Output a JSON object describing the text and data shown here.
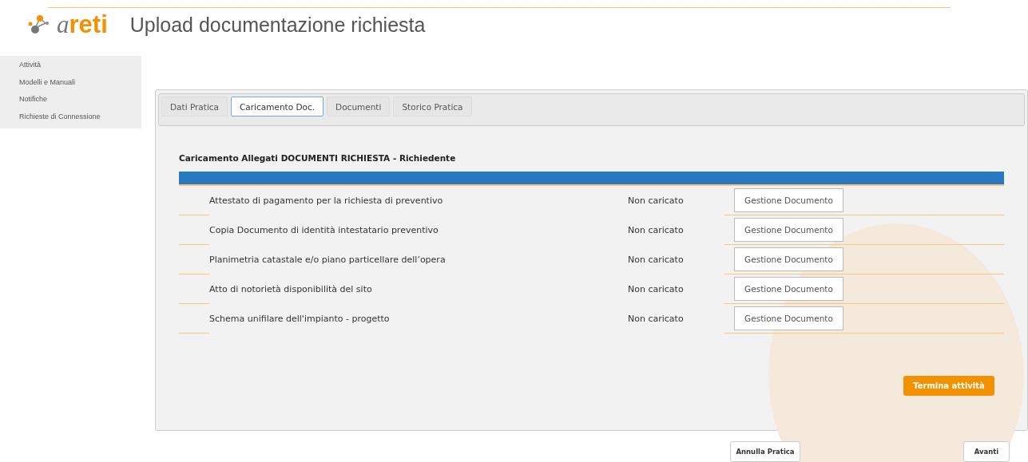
{
  "logo": {
    "prefix": "a",
    "name": "reti"
  },
  "page_title": "Upload documentazione richiesta",
  "sidebar": {
    "items": [
      {
        "label": "Attività"
      },
      {
        "label": "Modelli e Manuali"
      },
      {
        "label": "Notifiche"
      },
      {
        "label": "Richieste di Connessione"
      }
    ]
  },
  "tabs": [
    {
      "label": "Dati Pratica",
      "selected": false
    },
    {
      "label": "Caricamento Doc.",
      "selected": true
    },
    {
      "label": "Documenti",
      "selected": false
    },
    {
      "label": "Storico Pratica",
      "selected": false
    }
  ],
  "section_title": "Caricamento Allegati DOCUMENTI RICHIESTA - Richiedente",
  "documents": [
    {
      "name": "Attestato di pagamento per la richiesta di preventivo",
      "status": "Non caricato",
      "action": "Gestione Documento"
    },
    {
      "name": "Copia Documento di identità intestatario preventivo",
      "status": "Non caricato",
      "action": "Gestione Documento"
    },
    {
      "name": "Planimetria catastale e/o piano particellare dell’opera",
      "status": "Non caricato",
      "action": "Gestione Documento"
    },
    {
      "name": "Atto di notorietà disponibilità del sito",
      "status": "Non caricato",
      "action": "Gestione Documento"
    },
    {
      "name": "Schema unifilare dell'impianto - progetto",
      "status": "Non caricato",
      "action": "Gestione Documento"
    }
  ],
  "finish_button": "Termina attività",
  "footer_buttons": {
    "cancel": "Annulla Pratica",
    "next": "Avanti"
  }
}
